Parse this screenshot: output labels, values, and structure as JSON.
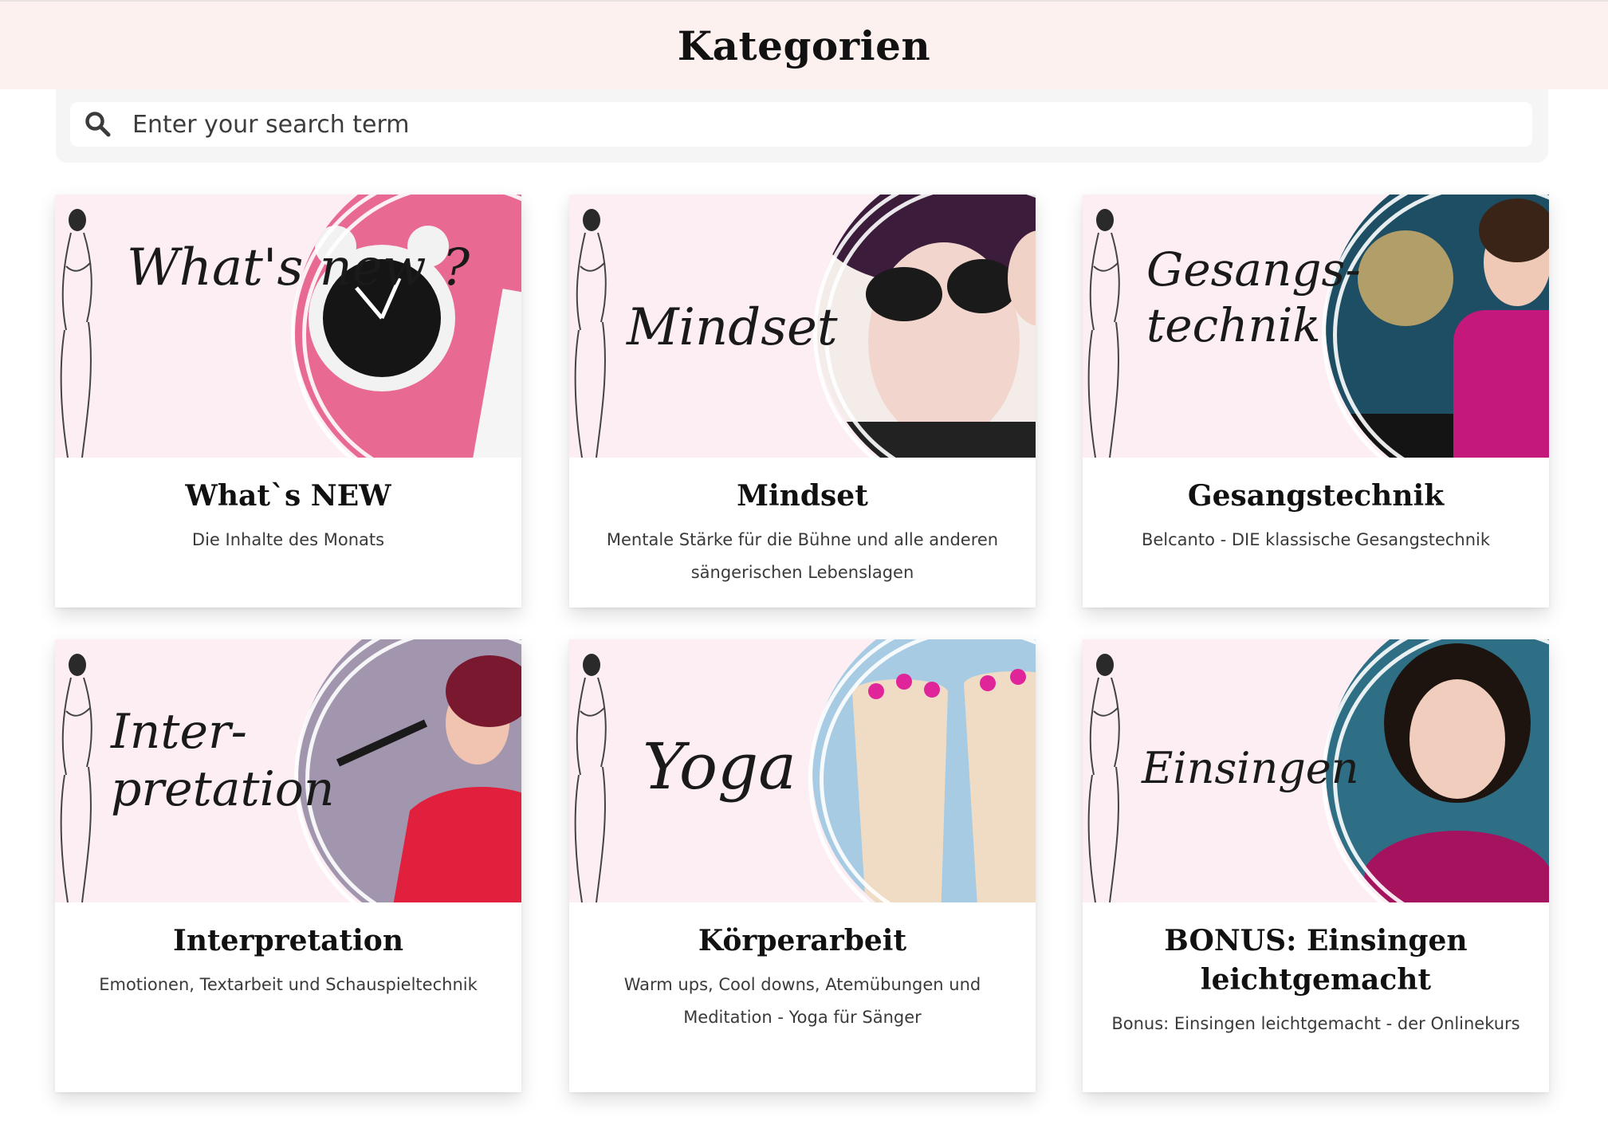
{
  "header": {
    "title": "Kategorien"
  },
  "search": {
    "placeholder": "Enter your search term"
  },
  "colors": {
    "header_bg": "#fcf1ef",
    "banner_bg": "#fdeef3",
    "accent_pink": "#e04e8a"
  },
  "categories": [
    {
      "banner_text": "What's new ?",
      "title": "What`s NEW",
      "description": "Die Inhalte des Monats",
      "icon": "alarm-clock-image"
    },
    {
      "banner_text": "Mindset",
      "title": "Mindset",
      "description": "Mentale Stärke für die Bühne und alle anderen sängerischen Lebenslagen",
      "icon": "woman-sunglasses-image"
    },
    {
      "banner_text": "Gesangs-technik",
      "title": "Gesangstechnik",
      "description": "Belcanto - DIE klassische Gesangstechnik",
      "icon": "singer-gesture-image"
    },
    {
      "banner_text": "Inter-pretation",
      "title": "Interpretation",
      "description": "Emotionen, Textarbeit und Schauspieltechnik",
      "icon": "singer-microphone-image"
    },
    {
      "banner_text": "Yoga",
      "title": "Körperarbeit",
      "description": "Warm ups, Cool downs, Atemübungen und Meditation - Yoga für Sänger",
      "icon": "feet-image"
    },
    {
      "banner_text": "Einsingen",
      "title": "BONUS: Einsingen leichtgemacht",
      "description": "Bonus: Einsingen leichtgemacht - der Onlinekurs",
      "icon": "smiling-woman-image"
    }
  ]
}
